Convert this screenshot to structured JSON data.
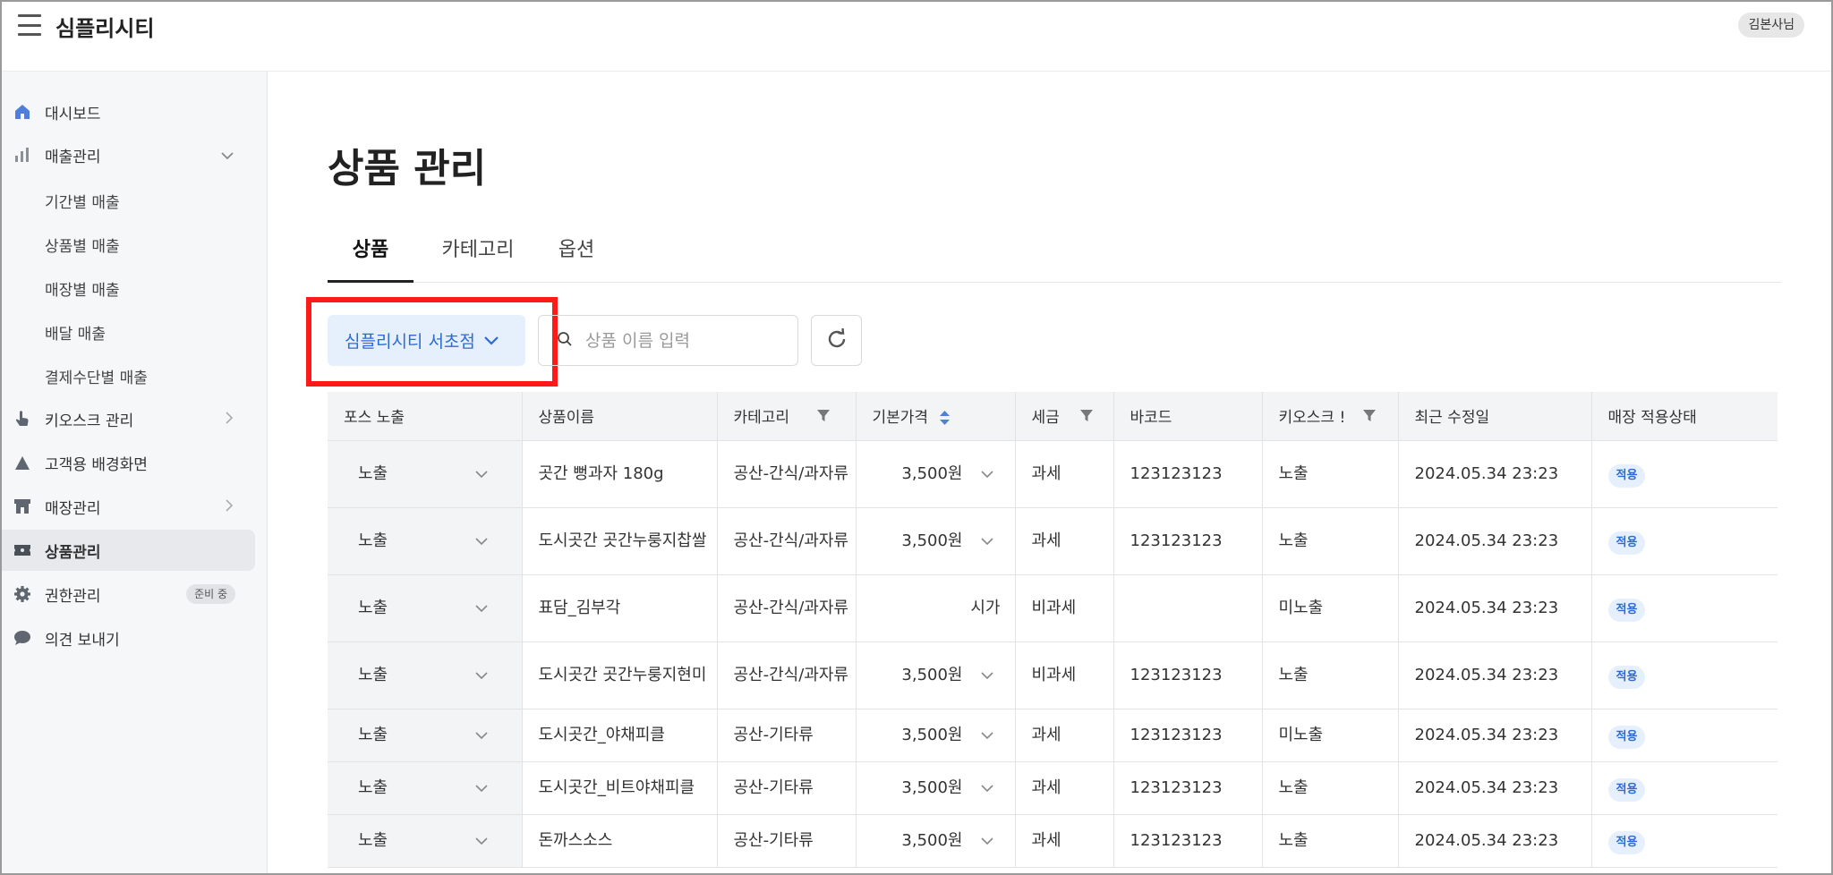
{
  "app": {
    "title": "심플리시티",
    "user": "김본사님"
  },
  "sidebar": {
    "items": [
      {
        "label": "대시보드"
      },
      {
        "label": "매출관리"
      },
      {
        "label": "키오스크 관리"
      },
      {
        "label": "고객용 배경화면"
      },
      {
        "label": "매장관리"
      },
      {
        "label": "상품관리"
      },
      {
        "label": "권한관리",
        "badge": "준비 중"
      },
      {
        "label": "의견 보내기"
      }
    ],
    "sales_sub": [
      "기간별 매출",
      "상품별 매출",
      "매장별 매출",
      "배달 매출",
      "결제수단별 매출"
    ]
  },
  "main": {
    "title": "상품 관리",
    "tabs": [
      {
        "label": "상품"
      },
      {
        "label": "카테고리"
      },
      {
        "label": "옵션"
      }
    ],
    "store_select": "심플리시티 서초점",
    "search": {
      "placeholder": "상품 이름 입력",
      "value": ""
    }
  },
  "table": {
    "headers": [
      "포스 노출",
      "상품이름",
      "카테고리",
      "기본가격",
      "세금",
      "바코드",
      "키오스크 !",
      "최근 수정일",
      "매장 적용상태"
    ],
    "rows": [
      {
        "pos": "노출",
        "name": "곳간 뻥과자 180g",
        "category": "공산-간식/과자류",
        "price": "3,500원",
        "tax": "과세",
        "barcode": "123123123",
        "kiosk": "노출",
        "updated": "2024.05.34 23:23",
        "status": "적용"
      },
      {
        "pos": "노출",
        "name": "도시곳간 곳간누룽지찹쌀",
        "category": "공산-간식/과자류",
        "price": "3,500원",
        "tax": "과세",
        "barcode": "123123123",
        "kiosk": "노출",
        "updated": "2024.05.34 23:23",
        "status": "적용"
      },
      {
        "pos": "노출",
        "name": "표담_김부각",
        "category": "공산-간식/과자류",
        "price": "시가",
        "tax": "비과세",
        "barcode": "",
        "kiosk": "미노출",
        "updated": "2024.05.34 23:23",
        "status": "적용"
      },
      {
        "pos": "노출",
        "name": "도시곳간 곳간누룽지현미",
        "category": "공산-간식/과자류",
        "price": "3,500원",
        "tax": "비과세",
        "barcode": "123123123",
        "kiosk": "노출",
        "updated": "2024.05.34 23:23",
        "status": "적용"
      },
      {
        "pos": "노출",
        "name": "도시곳간_야채피클",
        "category": "공산-기타류",
        "price": "3,500원",
        "tax": "과세",
        "barcode": "123123123",
        "kiosk": "미노출",
        "updated": "2024.05.34 23:23",
        "status": "적용"
      },
      {
        "pos": "노출",
        "name": "도시곳간_비트야채피클",
        "category": "공산-기타류",
        "price": "3,500원",
        "tax": "과세",
        "barcode": "123123123",
        "kiosk": "노출",
        "updated": "2024.05.34 23:23",
        "status": "적용"
      },
      {
        "pos": "노출",
        "name": "돈까스소스",
        "category": "공산-기타류",
        "price": "3,500원",
        "tax": "과세",
        "barcode": "123123123",
        "kiosk": "노출",
        "updated": "2024.05.34 23:23",
        "status": "적용"
      }
    ]
  },
  "colors": {
    "accent": "#2d6bd3",
    "accent_bg": "#e6f0fc",
    "highlight": "#ff1a1a",
    "sidebar_bg": "#f6f7f9"
  }
}
